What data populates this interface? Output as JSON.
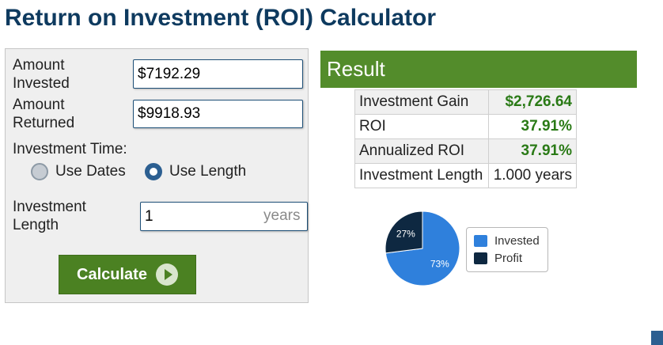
{
  "page": {
    "title": "Return on Investment (ROI) Calculator"
  },
  "form": {
    "amount_invested": {
      "label_line1": "Amount",
      "label_line2": "Invested",
      "value": "$7192.29"
    },
    "amount_returned": {
      "label_line1": "Amount",
      "label_line2": "Returned",
      "value": "$9918.93"
    },
    "investment_time": {
      "label": "Investment Time:",
      "options": [
        "Use Dates",
        "Use Length"
      ],
      "selected": "Use Length"
    },
    "investment_length": {
      "label_line1": "Investment",
      "label_line2": "Length",
      "value": "1",
      "suffix": "years"
    },
    "calculate_label": "Calculate"
  },
  "result": {
    "header": "Result",
    "rows": [
      {
        "label": "Investment Gain",
        "value": "$2,726.64"
      },
      {
        "label": "ROI",
        "value": "37.91%"
      },
      {
        "label": "Annualized ROI",
        "value": "37.91%"
      },
      {
        "label": "Investment Length",
        "value": "1.000 years"
      }
    ]
  },
  "chart_data": {
    "type": "pie",
    "categories": [
      "Invested",
      "Profit"
    ],
    "values": [
      73,
      27
    ],
    "labels": [
      "73%",
      "27%"
    ],
    "colors": [
      "#2f80dc",
      "#0e2841"
    ],
    "legend": "right"
  }
}
